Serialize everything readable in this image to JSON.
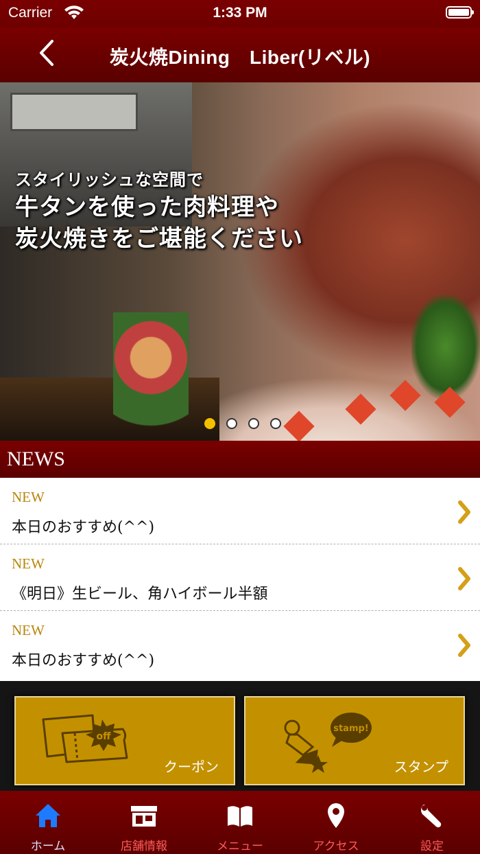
{
  "status_bar": {
    "carrier": "Carrier",
    "time": "1:33 PM"
  },
  "nav": {
    "title": "炭火焼Dining　Liber(リベル)"
  },
  "hero": {
    "line1": "スタイリッシュな空間で",
    "line2": "牛タンを使った肉料理や",
    "line3": "炭火焼きをご堪能ください",
    "slide_count": 4,
    "active_slide": 1
  },
  "news": {
    "header": "NEWS",
    "items": [
      {
        "tag": "NEW",
        "text": "本日のおすすめ(^^)"
      },
      {
        "tag": "NEW",
        "text": "《明日》生ビール、角ハイボール半額"
      },
      {
        "tag": "NEW",
        "text": "本日のおすすめ(^^)"
      }
    ]
  },
  "buttons": {
    "coupon": {
      "label": "クーポン",
      "badge": "off"
    },
    "stamp": {
      "label": "スタンプ",
      "bubble": "stamp!"
    }
  },
  "tabs": [
    {
      "label": "ホーム",
      "icon": "home-icon"
    },
    {
      "label": "店舗情報",
      "icon": "store-icon"
    },
    {
      "label": "メニュー",
      "icon": "book-icon"
    },
    {
      "label": "アクセス",
      "icon": "location-pin-icon"
    },
    {
      "label": "設定",
      "icon": "wrench-icon"
    }
  ],
  "colors": {
    "brand": "#7a0000",
    "gold": "#c39100",
    "active_tab": "#1e7bff",
    "inactive_tab": "#ff5a5a"
  }
}
